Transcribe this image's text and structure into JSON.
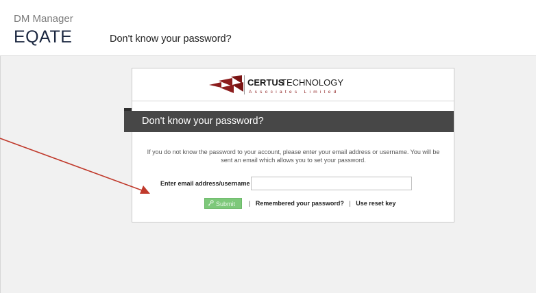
{
  "header": {
    "app_name": "DM Manager",
    "logo_text": "EQATE",
    "title": "Don't know your password?"
  },
  "brand": {
    "name_bold": "CERTUS",
    "name_light": "TECHNOLOGY",
    "tagline": "Associates Limited",
    "color": "#8c1d1d"
  },
  "form": {
    "banner": "Don't know your password?",
    "info": "If you do not know the password to your account, please enter your email address or username. You will be sent an email which allows you to set your password.",
    "field_label": "Enter email address/username",
    "field_value": "",
    "submit_label": "Submit",
    "submit_icon": "key-icon",
    "separator": "|",
    "remembered_link": "Remembered your password?",
    "reset_link": "Use reset key"
  },
  "colors": {
    "banner_bg": "#474747",
    "submit_bg": "#7dc87a",
    "annotation_arrow": "#c0392b"
  }
}
